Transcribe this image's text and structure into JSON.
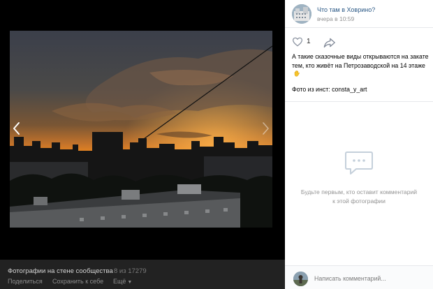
{
  "viewer": {
    "album_title": "Фотографии на стене сообщества",
    "counter": "8 из 17279",
    "actions": {
      "share": "Поделиться",
      "save": "Сохранить к себе",
      "more": "Ещё"
    }
  },
  "post": {
    "author": "Что там в Ховрино?",
    "date": "вчера в 10:59",
    "likes": "1",
    "caption": "А такие сказочные виды открываются на закате тем, кто живёт на Петрозаводской на 14 этаже",
    "source": "Фото из инст: consta_y_art"
  },
  "comments": {
    "empty_text": "Будьте первым, кто оставит комментарий к этой фотографии",
    "placeholder": "Написать комментарий..."
  },
  "colors": {
    "link": "#2a5885",
    "muted": "#939393",
    "footer_bg": "#222222",
    "sunset": "#f08a1c"
  }
}
